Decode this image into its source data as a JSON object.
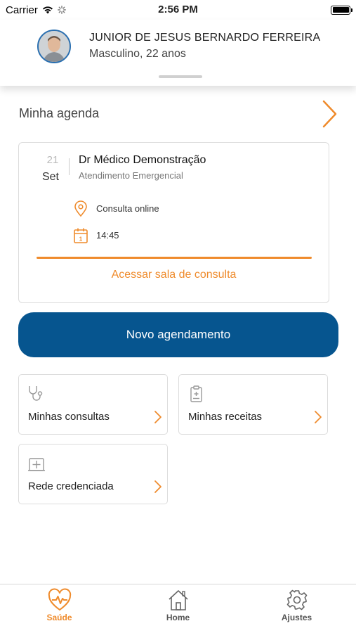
{
  "status_bar": {
    "carrier": "Carrier",
    "time": "2:56 PM"
  },
  "profile": {
    "name": "JUNIOR DE JESUS BERNARDO FERREIRA",
    "subtitle": "Masculino, 22 anos"
  },
  "agenda": {
    "title": "Minha agenda",
    "appointment": {
      "day": "21",
      "month": "Set",
      "doctor": "Dr Médico Demonstração",
      "specialty": "Atendimento Emergencial",
      "location": "Consulta online",
      "time": "14:45",
      "access_label": "Acessar sala de consulta"
    }
  },
  "new_appointment_label": "Novo agendamento",
  "tiles": [
    {
      "label": "Minhas consultas",
      "icon": "stethoscope-icon"
    },
    {
      "label": "Minhas receitas",
      "icon": "prescription-icon"
    },
    {
      "label": "Rede credenciada",
      "icon": "hospital-icon"
    }
  ],
  "tab_bar": {
    "tabs": [
      {
        "label": "Saúde",
        "icon": "heart-pulse-icon",
        "active": true
      },
      {
        "label": "Home",
        "icon": "home-icon",
        "active": false
      },
      {
        "label": "Ajustes",
        "icon": "gear-icon",
        "active": false
      }
    ]
  },
  "colors": {
    "accent": "#ef8b2c",
    "primary": "#06558f",
    "avatar_border": "#2a6fb0"
  }
}
